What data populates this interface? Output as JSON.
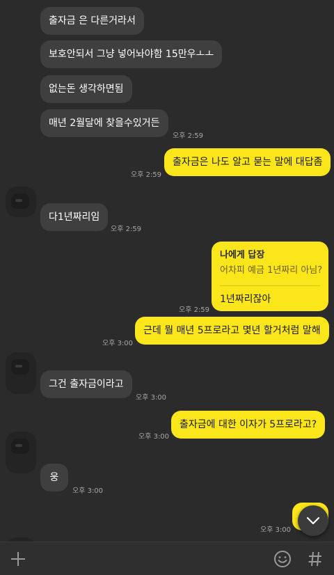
{
  "messages": {
    "m1": {
      "text": "출자금 은 다른거라서"
    },
    "m2": {
      "text": "보호안되서 그냥 넣어놔야함 15만우ㅗㅗ"
    },
    "m3": {
      "text": "없는돈 생각하면됨"
    },
    "m4": {
      "text": "매년 2월달에 찾을수있거든",
      "time": "오후 2:59"
    },
    "m5": {
      "text": "출자금은 나도 알고 묻는 말에 대답좀",
      "time": "오후 2:59"
    },
    "m6": {
      "text": "다1년짜리임",
      "time": "오후 2:59"
    },
    "m7": {
      "reply_header": "나에게 답장",
      "reply_quote": "어차피 예금 1년짜리 아님?",
      "text": "1년짜리잖아",
      "time": "오후 2:59"
    },
    "m8": {
      "text": "근데 뭘 매년 5프로라고 몇년 할거처럼 말해",
      "time": "오후 3:00"
    },
    "m9": {
      "text": "그건 출자금이라고",
      "time": "오후 3:00"
    },
    "m10": {
      "text": "출자금에 대한 이자가 5프로라고?",
      "time": "오후 3:00"
    },
    "m11": {
      "text": "웅",
      "time": "오후 3:00"
    },
    "m12": {
      "time": "오후 3:00"
    }
  },
  "colors": {
    "background": "#2b2b2b",
    "incoming_bubble": "#3f3f3f",
    "outgoing_bubble": "#fbe51b"
  },
  "icons": {
    "attach": "plus-icon",
    "emoji": "emoji-icon",
    "hashtag": "hashtag-icon",
    "scroll": "chevron-down-icon"
  }
}
